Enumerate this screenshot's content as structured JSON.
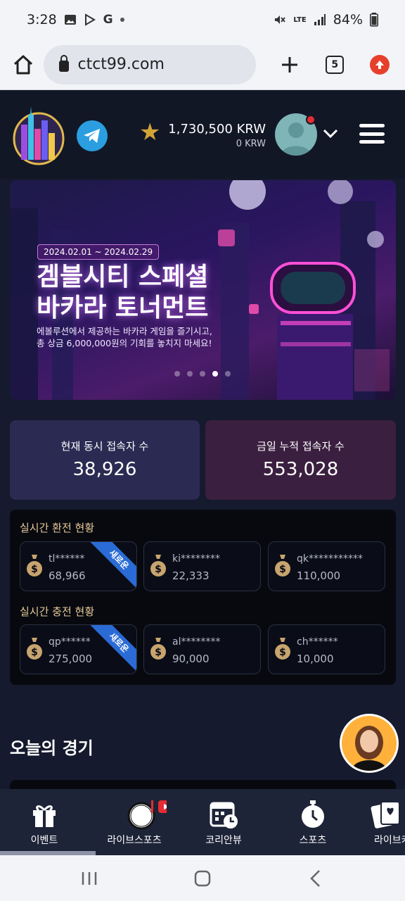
{
  "status_bar": {
    "time": "3:28",
    "notif_letter": "G",
    "network": "LTE",
    "battery": "84%"
  },
  "browser": {
    "url": "ctct99.com",
    "tab_count": "5"
  },
  "header": {
    "balance_main": "1,730,500 KRW",
    "balance_sub": "0 KRW"
  },
  "banner": {
    "date_range": "2024.02.01 ~ 2024.02.29",
    "title_line1": "겜블시티 스페셜",
    "title_line2": "바카라 토너먼트",
    "sub_line1": "에볼루션에서 제공하는 바카라 게임을 즐기시고,",
    "sub_line2": "총 상금 6,000,000원의 기회를 놓치지 마세요!",
    "active_slide": 3,
    "slide_count": 5
  },
  "stats": [
    {
      "label": "현재 동시 접속자 수",
      "value": "38,926"
    },
    {
      "label": "금일 누적 접속자 수",
      "value": "553,028"
    }
  ],
  "withdraw": {
    "title": "실시간 환전 현황",
    "items": [
      {
        "name": "tl******",
        "amount": "68,966",
        "badge": "새로운"
      },
      {
        "name": "ki********",
        "amount": "22,333",
        "badge": ""
      },
      {
        "name": "qk***********",
        "amount": "110,000",
        "badge": ""
      }
    ]
  },
  "deposit": {
    "title": "실시간 충전 현황",
    "items": [
      {
        "name": "qp******",
        "amount": "275,000",
        "badge": "새로운"
      },
      {
        "name": "al********",
        "amount": "90,000",
        "badge": ""
      },
      {
        "name": "ch******",
        "amount": "10,000",
        "badge": ""
      }
    ]
  },
  "today": {
    "title": "오늘의 경기"
  },
  "bottom_nav": [
    {
      "label": "이벤트",
      "icon": "gift-icon"
    },
    {
      "label": "라이브스포츠",
      "icon": "live-sports-icon"
    },
    {
      "label": "코리안뷰",
      "icon": "calendar-clock-icon"
    },
    {
      "label": "스포츠",
      "icon": "stopwatch-icon"
    },
    {
      "label": "라이브카",
      "icon": "cards-icon"
    }
  ],
  "colors": {
    "page_bg": "#151a2e",
    "accent_gold": "#e8c99a",
    "badge_blue": "#2a6bd6",
    "stat_left": "#2b2a52",
    "stat_right": "#3b1f40"
  }
}
